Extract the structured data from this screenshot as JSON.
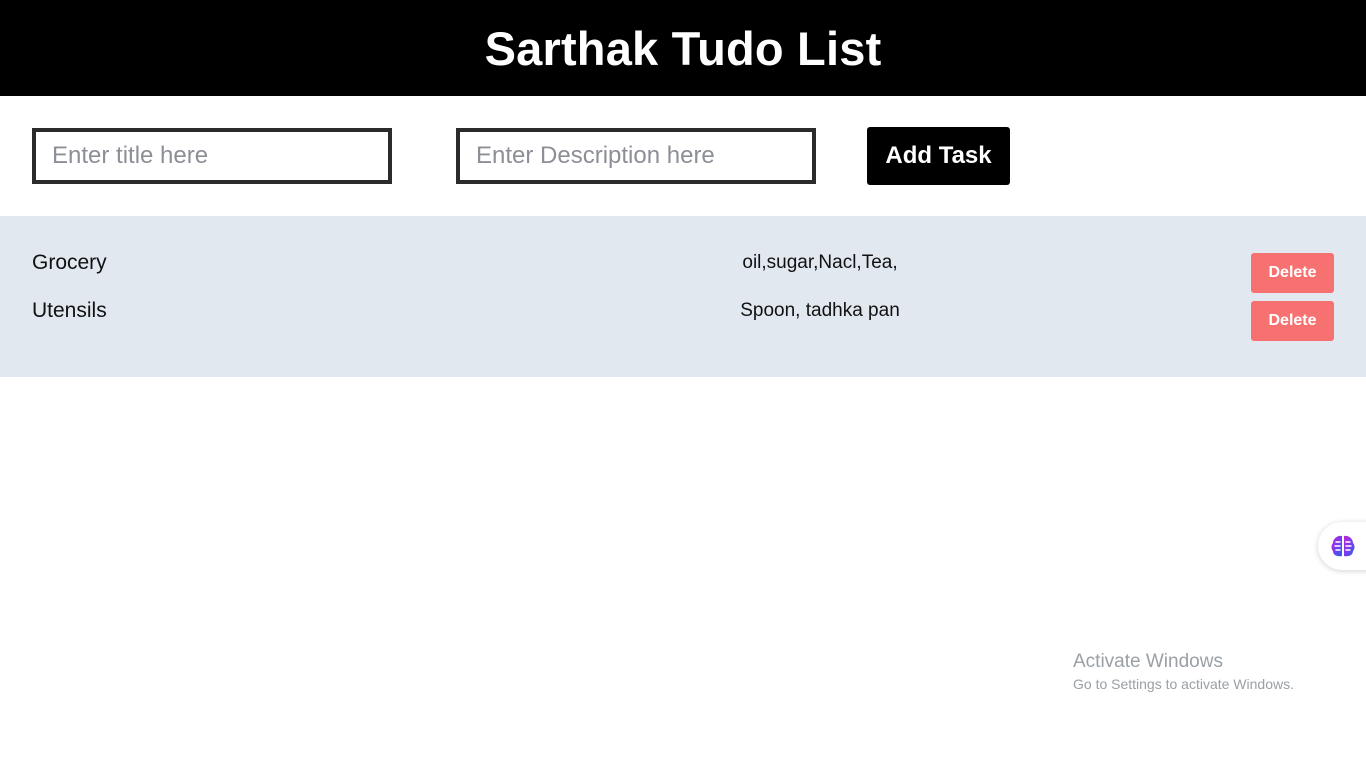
{
  "header": {
    "title": "Sarthak Tudo List"
  },
  "form": {
    "title_placeholder": "Enter title here",
    "title_value": "",
    "description_placeholder": "Enter Description here",
    "description_value": "",
    "add_label": "Add Task"
  },
  "tasks": [
    {
      "title": "Grocery",
      "description": "oil,sugar,Nacl,Tea,",
      "delete_label": "Delete"
    },
    {
      "title": "Utensils",
      "description": "Spoon, tadhka pan",
      "delete_label": "Delete"
    }
  ],
  "assistant": {
    "icon": "brain-icon"
  },
  "watermark": {
    "title": "Activate Windows",
    "subtitle": "Go to Settings to activate Windows."
  },
  "colors": {
    "header_bg": "#000000",
    "list_bg": "#e2e8f0",
    "delete_bg": "#f87171",
    "button_bg": "#000000"
  }
}
